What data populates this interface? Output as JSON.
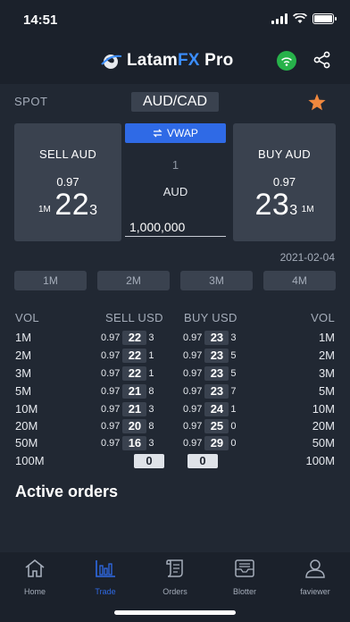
{
  "status": {
    "time": "14:51"
  },
  "header": {
    "brand_a": "LatamFX",
    "brand_fx": "FX",
    "brand_b": "Pro"
  },
  "spot": {
    "label": "SPOT",
    "pair": "AUD/CAD"
  },
  "sell_card": {
    "title": "SELL AUD",
    "prefix": "0.97",
    "big": "22",
    "pip": "3",
    "size": "1M"
  },
  "buy_card": {
    "title": "BUY AUD",
    "prefix": "0.97",
    "big": "23",
    "pip": "3",
    "size": "1M"
  },
  "center": {
    "vwap_label": "VWAP",
    "one": "1",
    "currency": "AUD",
    "amount": "1,000,000"
  },
  "value_date": "2021-02-04",
  "tenors": [
    "1M",
    "2M",
    "3M",
    "4M"
  ],
  "ladder": {
    "headers": {
      "vol_left": "VOL",
      "sell": "SELL USD",
      "buy": "BUY USD",
      "vol_right": "VOL"
    },
    "rows": [
      {
        "vol": "1M",
        "sell_pre": "0.97",
        "sell_big": "22",
        "sell_pip": "3",
        "buy_pre": "0.97",
        "buy_big": "23",
        "buy_pip": "3"
      },
      {
        "vol": "2M",
        "sell_pre": "0.97",
        "sell_big": "22",
        "sell_pip": "1",
        "buy_pre": "0.97",
        "buy_big": "23",
        "buy_pip": "5"
      },
      {
        "vol": "3M",
        "sell_pre": "0.97",
        "sell_big": "22",
        "sell_pip": "1",
        "buy_pre": "0.97",
        "buy_big": "23",
        "buy_pip": "5"
      },
      {
        "vol": "5M",
        "sell_pre": "0.97",
        "sell_big": "21",
        "sell_pip": "8",
        "buy_pre": "0.97",
        "buy_big": "23",
        "buy_pip": "7"
      },
      {
        "vol": "10M",
        "sell_pre": "0.97",
        "sell_big": "21",
        "sell_pip": "3",
        "buy_pre": "0.97",
        "buy_big": "24",
        "buy_pip": "1"
      },
      {
        "vol": "20M",
        "sell_pre": "0.97",
        "sell_big": "20",
        "sell_pip": "8",
        "buy_pre": "0.97",
        "buy_big": "25",
        "buy_pip": "0"
      },
      {
        "vol": "50M",
        "sell_pre": "0.97",
        "sell_big": "16",
        "sell_pip": "3",
        "buy_pre": "0.97",
        "buy_big": "29",
        "buy_pip": "0"
      },
      {
        "vol": "100M",
        "sell_big": "0",
        "buy_big": "0"
      }
    ]
  },
  "active_orders_title": "Active orders",
  "tabs": [
    {
      "label": "Home",
      "icon": "home-icon"
    },
    {
      "label": "Trade",
      "icon": "trade-icon",
      "active": true
    },
    {
      "label": "Orders",
      "icon": "orders-icon"
    },
    {
      "label": "Blotter",
      "icon": "blotter-icon"
    },
    {
      "label": "faviewer",
      "icon": "user-icon"
    }
  ],
  "colors": {
    "background": "#212833",
    "accent": "#2f6ae6",
    "star": "#f0883e",
    "online": "#27b24a"
  }
}
